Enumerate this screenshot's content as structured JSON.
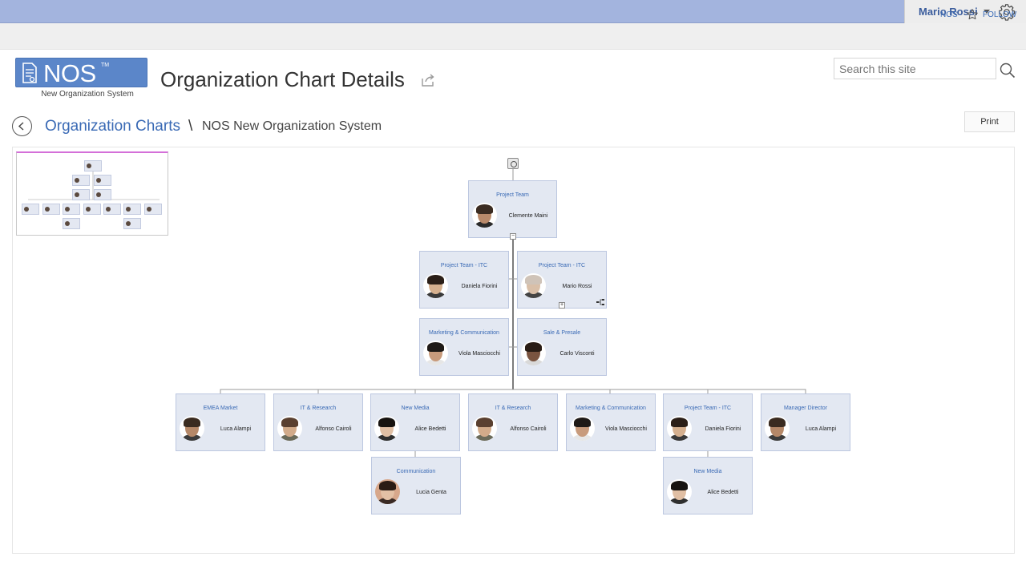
{
  "header": {
    "username": "Mario Rossi",
    "sub_links": {
      "nos": "NOS",
      "follow": "FOLLOW"
    }
  },
  "logo": {
    "text": "NOS",
    "tm": "TM",
    "subtitle": "New Organization System"
  },
  "page": {
    "title": "Organization Chart Details"
  },
  "search": {
    "placeholder": "Search this site"
  },
  "breadcrumb": {
    "link": "Organization Charts",
    "separator": "\\",
    "current": "NOS New Organization System"
  },
  "toolbar": {
    "print_label": "Print"
  },
  "org_chart": {
    "root": {
      "role": "Project Team",
      "name": "Clemente Maini"
    },
    "assistants_left": [
      {
        "role": "Project Team - ITC",
        "name": "Daniela Fiorini"
      },
      {
        "role": "Marketing & Communication",
        "name": "Viola Masciocchi"
      }
    ],
    "assistants_right": [
      {
        "role": "Project Team - ITC",
        "name": "Mario Rossi"
      },
      {
        "role": "Sale & Presale",
        "name": "Carlo Visconti"
      }
    ],
    "children": [
      {
        "role": "EMEA Market",
        "name": "Luca Alampi"
      },
      {
        "role": "IT & Research",
        "name": "Alfonso Cairoli"
      },
      {
        "role": "New Media",
        "name": "Alice Bedetti"
      },
      {
        "role": "IT & Research",
        "name": "Alfonso Cairoli"
      },
      {
        "role": "Marketing & Communication",
        "name": "Viola Masciocchi"
      },
      {
        "role": "Project Team - ITC",
        "name": "Daniela Fiorini"
      },
      {
        "role": "Manager Director",
        "name": "Luca Alampi"
      }
    ],
    "grandchildren": [
      {
        "role": "Communication",
        "name": "Lucia Genta"
      },
      {
        "role": "New Media",
        "name": "Alice Bedetti"
      }
    ]
  },
  "colors": {
    "topbar": "#a3b4de",
    "accent": "#3a6ab5",
    "node_bg": "#e3e8f2",
    "minimap_border": "#d46fd8"
  },
  "icons": [
    "gear-icon",
    "caret-down-icon",
    "star-icon",
    "share-icon",
    "search-icon",
    "back-arrow-icon",
    "collapse-icon",
    "expand-icon",
    "hierarchy-icon"
  ]
}
